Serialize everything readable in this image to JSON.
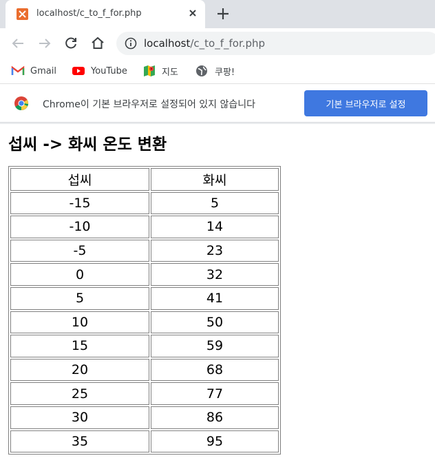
{
  "browser": {
    "tab": {
      "title": "localhost/c_to_f_for.php",
      "favicon": "xampp-icon"
    },
    "toolbar": {
      "url_host": "localhost",
      "url_path": "/c_to_f_for.php"
    },
    "bookmarks": [
      {
        "label": "Gmail",
        "icon": "gmail-icon"
      },
      {
        "label": "YouTube",
        "icon": "youtube-icon"
      },
      {
        "label": "지도",
        "icon": "maps-icon"
      },
      {
        "label": "쿠팡!",
        "icon": "globe-icon"
      }
    ],
    "infobar": {
      "message": "Chrome이 기본 브라우저로 설정되어 있지 않습니다",
      "button_label": "기본 브라우저로 설정"
    },
    "colors": {
      "accent": "#3f78e0",
      "tabstrip": "#dee1e6"
    }
  },
  "page": {
    "title": "섭씨 -> 화씨 온도 변환",
    "table": {
      "headers": [
        "섭씨",
        "화씨"
      ],
      "rows": [
        [
          "-15",
          "5"
        ],
        [
          "-10",
          "14"
        ],
        [
          "-5",
          "23"
        ],
        [
          "0",
          "32"
        ],
        [
          "5",
          "41"
        ],
        [
          "10",
          "50"
        ],
        [
          "15",
          "59"
        ],
        [
          "20",
          "68"
        ],
        [
          "25",
          "77"
        ],
        [
          "30",
          "86"
        ],
        [
          "35",
          "95"
        ]
      ]
    }
  }
}
